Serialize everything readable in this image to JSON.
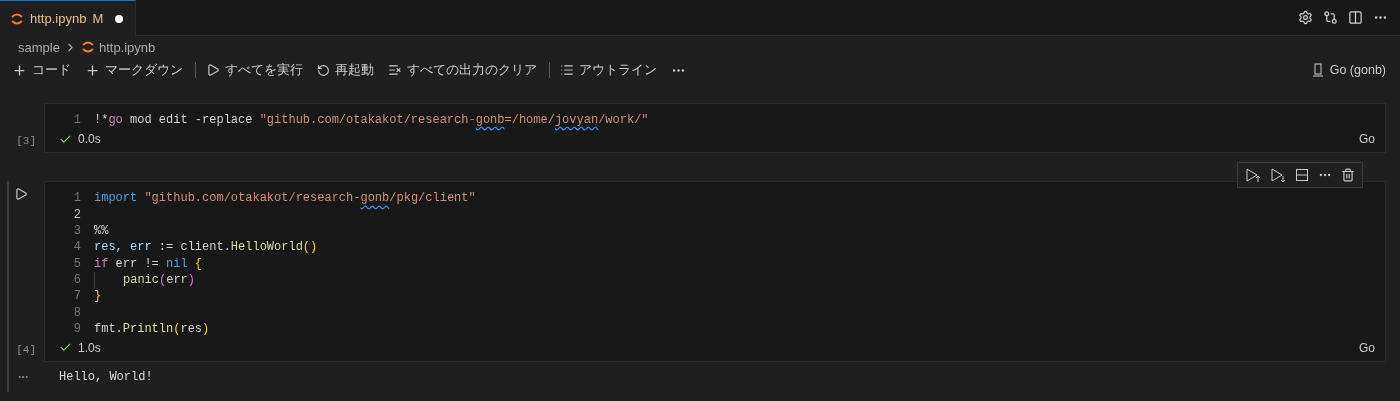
{
  "tab": {
    "label": "http.ipynb",
    "badge": "M",
    "dirty": true,
    "selected": true
  },
  "breadcrumb": [
    "sample",
    "http.ipynb"
  ],
  "toolbar": [
    {
      "kind": "add",
      "label": "コード"
    },
    {
      "kind": "add",
      "label": "マークダウン"
    },
    {
      "kind": "separator"
    },
    {
      "kind": "run",
      "label": "すべてを実行"
    },
    {
      "kind": "restart",
      "label": "再起動"
    },
    {
      "kind": "clear",
      "label": "すべての出力のクリア"
    },
    {
      "kind": "separator"
    },
    {
      "kind": "outline",
      "label": "アウトライン"
    },
    {
      "kind": "more"
    }
  ],
  "kernel": "Go (gonb)",
  "cells": [
    {
      "selected": false,
      "execution_count": "[3]",
      "success": true,
      "duration": "0.0s",
      "language": "Go",
      "lines": [
        {
          "number": "1",
          "active": false,
          "tokens": [
            {
              "kind": "plain",
              "text": "!*"
            },
            {
              "kind": "control",
              "text": "go"
            },
            {
              "kind": "plain",
              "text": " mod edit -replace "
            },
            {
              "kind": "string",
              "text": "\"github.com/otakakot/research-"
            },
            {
              "kind": "string",
              "text": "gonb",
              "squiggle": true
            },
            {
              "kind": "string",
              "text": "=/home/"
            },
            {
              "kind": "string",
              "text": "jovyan",
              "squiggle": true
            },
            {
              "kind": "string",
              "text": "/work/\""
            }
          ]
        }
      ]
    },
    {
      "selected": true,
      "execution_count": "[4]",
      "success": true,
      "duration": "1.0s",
      "language": "Go",
      "lines": [
        {
          "number": "1",
          "active": false,
          "tokens": [
            {
              "kind": "keyword",
              "text": "import"
            },
            {
              "kind": "string",
              "text": " \"github.com/otakakot/research-"
            },
            {
              "kind": "string",
              "text": "gonb",
              "squiggle": true
            },
            {
              "kind": "string",
              "text": "/pkg/client\""
            }
          ]
        },
        {
          "number": "2",
          "active": true
        },
        {
          "number": "3",
          "active": false,
          "tokens": [
            {
              "kind": "plain",
              "text": "%%"
            }
          ]
        },
        {
          "number": "4",
          "active": false,
          "tokens": [
            {
              "kind": "variable",
              "text": "res"
            },
            {
              "kind": "plain",
              "text": ", "
            },
            {
              "kind": "variable",
              "text": "err"
            },
            {
              "kind": "plain",
              "text": " := client."
            },
            {
              "kind": "function",
              "text": "HelloWorld"
            },
            {
              "kind": "bracket",
              "text": "()"
            }
          ]
        },
        {
          "number": "5",
          "active": false,
          "tokens": [
            {
              "kind": "control",
              "text": "if"
            },
            {
              "kind": "plain",
              "text": " err != "
            },
            {
              "kind": "keyword",
              "text": "nil"
            },
            {
              "kind": "bracket",
              "text": " {"
            }
          ]
        },
        {
          "number": "6",
          "active": false,
          "indent": true,
          "tokens": [
            {
              "kind": "function",
              "text": "panic"
            },
            {
              "kind": "bracket2",
              "text": "("
            },
            {
              "kind": "plain",
              "text": "err"
            },
            {
              "kind": "bracket2",
              "text": ")"
            }
          ]
        },
        {
          "number": "7",
          "active": false,
          "tokens": [
            {
              "kind": "bracket",
              "text": "}"
            }
          ]
        },
        {
          "number": "8",
          "active": false
        },
        {
          "number": "9",
          "active": false,
          "tokens": [
            {
              "kind": "plain",
              "text": "fmt."
            },
            {
              "kind": "function",
              "text": "Println"
            },
            {
              "kind": "bracket",
              "text": "("
            },
            {
              "kind": "plain",
              "text": "res"
            },
            {
              "kind": "bracket",
              "text": ")"
            }
          ]
        }
      ],
      "output": "Hello, World!"
    }
  ]
}
